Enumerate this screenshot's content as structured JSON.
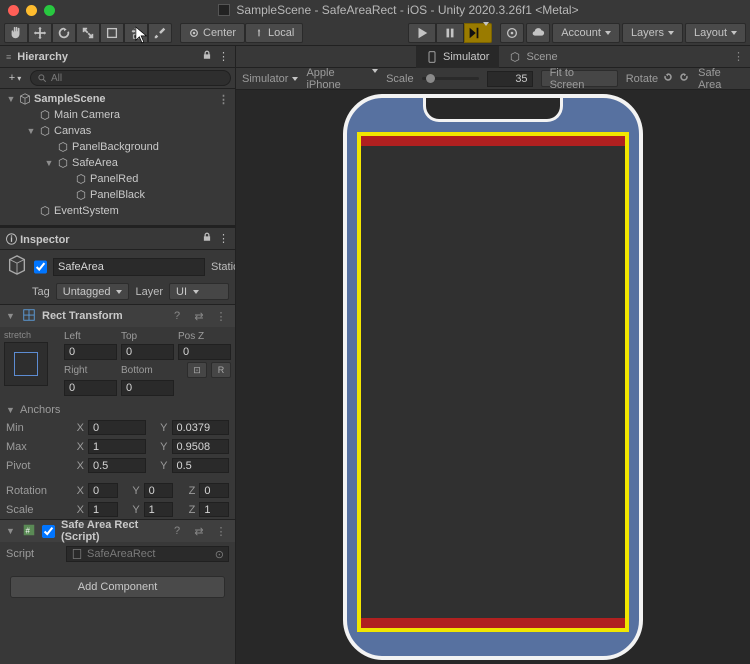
{
  "window": {
    "title": "SampleScene - SafeAreaRect - iOS - Unity 2020.3.26f1 <Metal>"
  },
  "toolbar": {
    "center": "Center",
    "local": "Local",
    "account": "Account",
    "layers": "Layers",
    "layout": "Layout"
  },
  "hierarchy": {
    "title": "Hierarchy",
    "search_placeholder": "All",
    "items": [
      {
        "label": "SampleScene",
        "type": "scene"
      },
      {
        "label": "Main Camera"
      },
      {
        "label": "Canvas"
      },
      {
        "label": "PanelBackground"
      },
      {
        "label": "SafeArea"
      },
      {
        "label": "PanelRed"
      },
      {
        "label": "PanelBlack"
      },
      {
        "label": "EventSystem"
      }
    ]
  },
  "inspector": {
    "title": "Inspector",
    "go": {
      "name": "SafeArea",
      "enabled": true,
      "static_label": "Static"
    },
    "tag": {
      "label": "Tag",
      "value": "Untagged"
    },
    "layer": {
      "label": "Layer",
      "value": "UI"
    },
    "rect": {
      "title": "Rect Transform",
      "anchor_preset_v": "custom",
      "anchor_preset_h": "stretch",
      "left_label": "Left",
      "top_label": "Top",
      "posz_label": "Pos Z",
      "left": "0",
      "top": "0",
      "posz": "0",
      "right_label": "Right",
      "bottom_label": "Bottom",
      "right": "0",
      "bottom": "0",
      "anchors_label": "Anchors",
      "min_label": "Min",
      "min_x": "0",
      "min_y": "0.0379",
      "max_label": "Max",
      "max_x": "1",
      "max_y": "0.9508",
      "pivot_label": "Pivot",
      "pivot_x": "0.5",
      "pivot_y": "0.5",
      "rotation_label": "Rotation",
      "rot_x": "0",
      "rot_y": "0",
      "rot_z": "0",
      "scale_label": "Scale",
      "scl_x": "1",
      "scl_y": "1",
      "scl_z": "1",
      "blueprint_label": "⊡",
      "raw_label": "R"
    },
    "script": {
      "title": "Safe Area Rect (Script)",
      "field_label": "Script",
      "ref": "SafeAreaRect"
    },
    "add_component": "Add Component"
  },
  "simulator": {
    "tabs": {
      "simulator": "Simulator",
      "scene": "Scene"
    },
    "mode": "Simulator",
    "device": "Apple iPhone",
    "scale_label": "Scale",
    "scale_value": "35",
    "fit": "Fit to Screen",
    "rotate": "Rotate",
    "safe_toggle": "Safe Area"
  }
}
